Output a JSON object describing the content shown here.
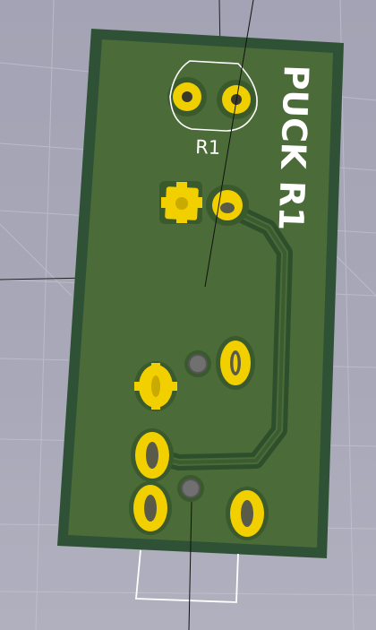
{
  "viewer": {
    "board_text": "PUCK R1",
    "component_ref": "R1"
  },
  "colors": {
    "background": "#a8a8b8",
    "board_edge": "#2f5236",
    "board_fill": "#4a6a38",
    "copper_trace": "#3f5f31",
    "pad_gold": "#f2d000",
    "pad_ring_dark": "#2a2a22",
    "drill_hole": "#6e6e6e",
    "silkscreen": "#ffffff",
    "grid_line": "#c4c4d0"
  },
  "icons": {
    "square_pad": "square-pad-icon",
    "round_pad": "round-pad-icon",
    "oval_pad": "oval-pad-icon",
    "via": "via-icon"
  }
}
